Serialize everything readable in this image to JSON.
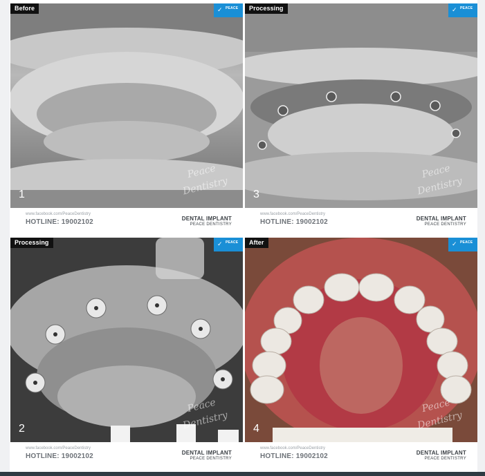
{
  "panels": [
    {
      "stage": "Before",
      "number": "1",
      "watermark": "Peace Dentistry",
      "fb_url": "www.facebook.com/PeaceDentistry",
      "hotline": "HOTLINE: 19002102",
      "service": "DENTAL IMPLANT",
      "clinic": "PEACE DENTISTRY",
      "photo": "edentulous upper jaw, grayscale"
    },
    {
      "stage": "Processing",
      "number": "3",
      "watermark": "Peace Dentistry",
      "fb_url": "www.facebook.com/PeaceDentistry",
      "hotline": "HOTLINE: 19002102",
      "service": "DENTAL IMPLANT",
      "clinic": "PEACE DENTISTRY",
      "photo": "upper jaw with implants placed and sutures, grayscale"
    },
    {
      "stage": "Processing",
      "number": "2",
      "watermark": "Peace Dentistry",
      "fb_url": "www.facebook.com/PeaceDentistry",
      "hotline": "HOTLINE: 19002102",
      "service": "DENTAL IMPLANT",
      "clinic": "PEACE DENTISTRY",
      "photo": "upper jaw with healing abutments, grayscale"
    },
    {
      "stage": "After",
      "number": "4",
      "watermark": "Peace Dentistry",
      "fb_url": "www.facebook.com/PeaceDentistry",
      "hotline": "HOTLINE: 19002102",
      "service": "DENTAL IMPLANT",
      "clinic": "PEACE DENTISTRY",
      "photo": "completed full-arch implant bridge, color"
    }
  ],
  "logo": {
    "brand": "PEACE",
    "icon": "bird-logo-icon",
    "color": "#1a8fd6"
  }
}
